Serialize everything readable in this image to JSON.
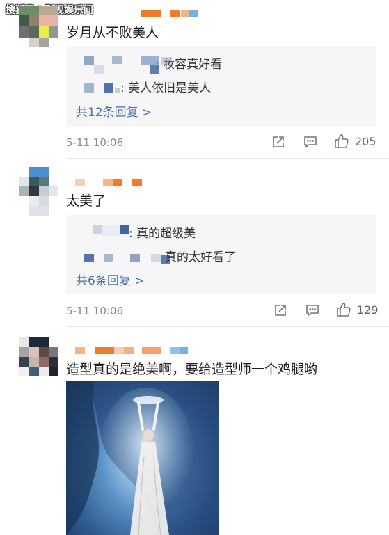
{
  "watermark": "搜狐号@影视娱乐间",
  "comments": [
    {
      "text": "岁月从不败美人",
      "replies": [
        ": 妆容真好看",
        ": 美人依旧是美人"
      ],
      "more_replies": "共12条回复 >",
      "timestamp": "5-11 10:06",
      "likes": "205"
    },
    {
      "text": "太美了",
      "replies": [
        ": 真的超级美",
        "真的太好看了"
      ],
      "more_replies": "共6条回复 >",
      "timestamp": "5-11 10:06",
      "likes": "129"
    },
    {
      "text": "造型真的是绝美啊，要给造型师一个鸡腿哟"
    }
  ],
  "icons": {
    "repost": "share-icon",
    "comment": "comment-icon",
    "like": "like-icon"
  },
  "colors": {
    "link": "#4a6ea9",
    "username_mosaic": "#f07c2a",
    "reply_box": "#f6f6f6"
  }
}
